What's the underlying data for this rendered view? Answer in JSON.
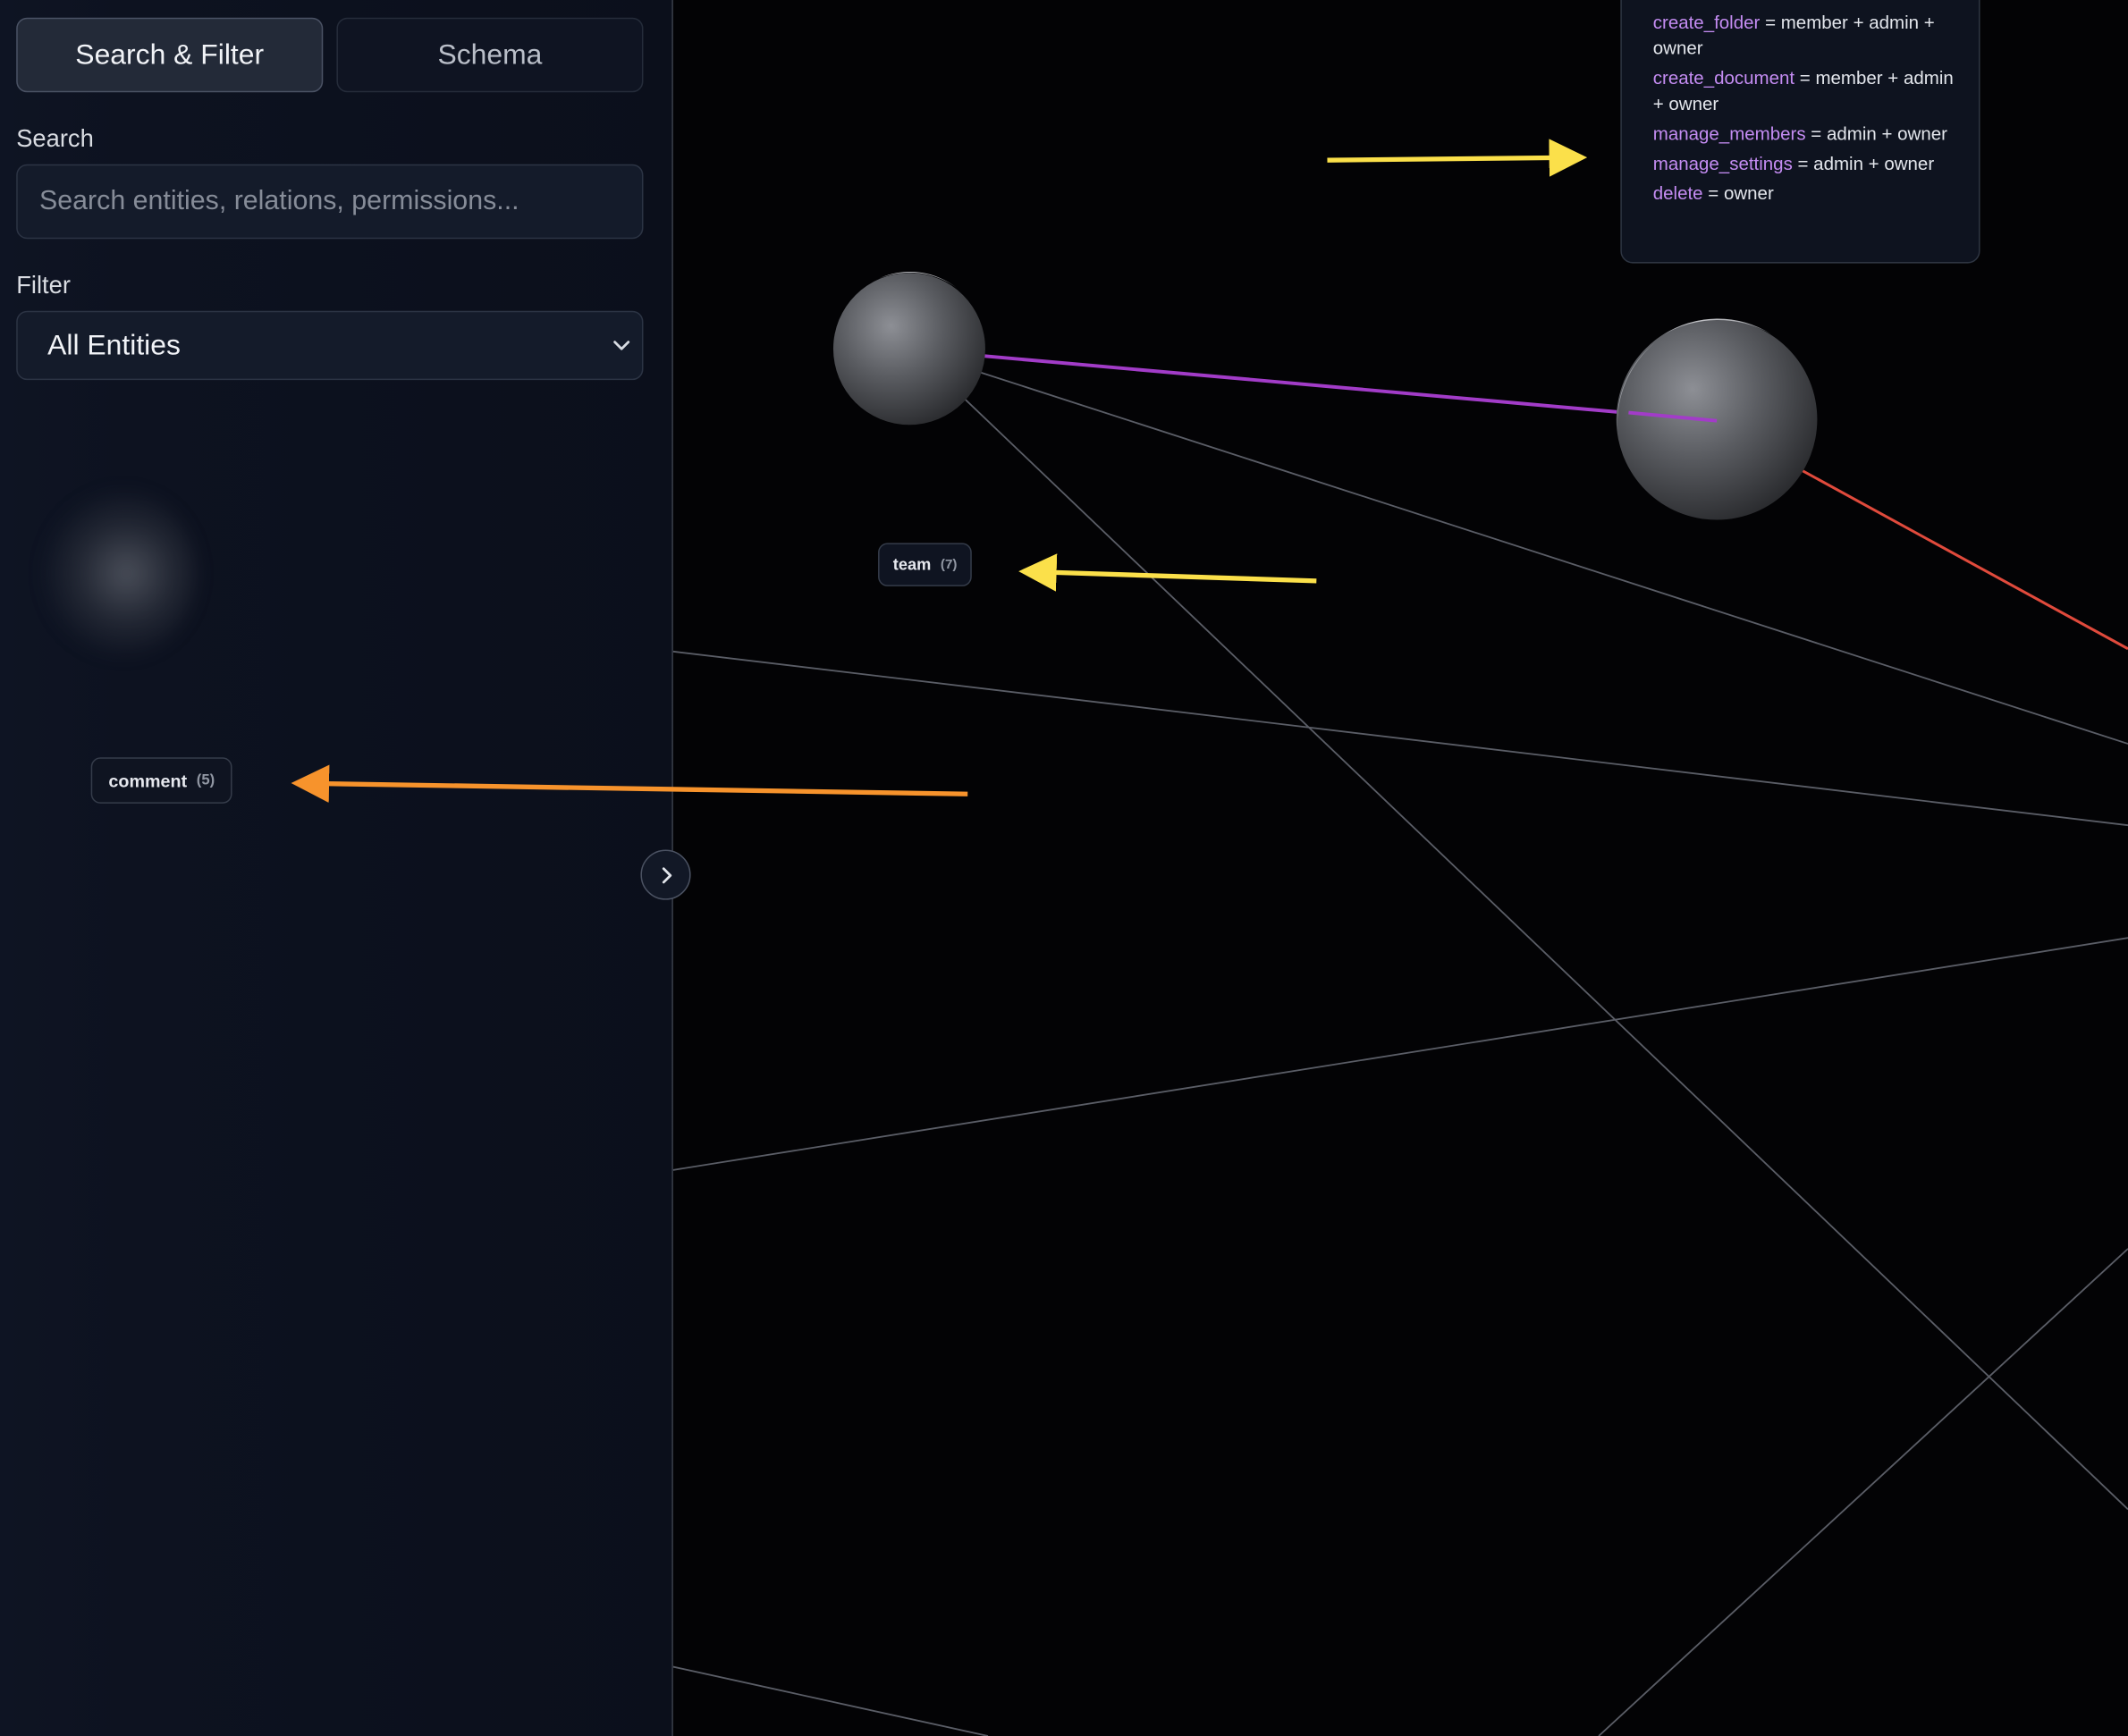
{
  "sidebar": {
    "tabs": [
      {
        "label": "Search & Filter",
        "active": true
      },
      {
        "label": "Schema",
        "active": false
      }
    ],
    "search": {
      "label": "Search",
      "placeholder": "Search entities, relations, permissions...",
      "value": ""
    },
    "filter": {
      "label": "Filter",
      "selected": "All Entities"
    }
  },
  "graph": {
    "nodes": [
      {
        "label": "team",
        "count": "(7)"
      },
      {
        "label": "comment",
        "count": "(5)"
      }
    ],
    "permissions_panel": {
      "rows": [
        {
          "name": "create_folder",
          "expr": " = member + admin + owner"
        },
        {
          "name": "create_document",
          "expr": " = member + admin + owner"
        },
        {
          "name": "manage_members",
          "expr": " = admin + owner"
        },
        {
          "name": "manage_settings",
          "expr": " = admin + owner"
        },
        {
          "name": "delete",
          "expr": " = owner"
        }
      ]
    },
    "colors": {
      "background": "#030305",
      "edge_neutral": "#5a5d66",
      "edge_purple": "#a23cc8",
      "edge_red": "#e04a3c",
      "arrow_yellow": "#fbe04a",
      "arrow_orange": "#f7932c",
      "permission_name": "#c48cf2"
    }
  }
}
